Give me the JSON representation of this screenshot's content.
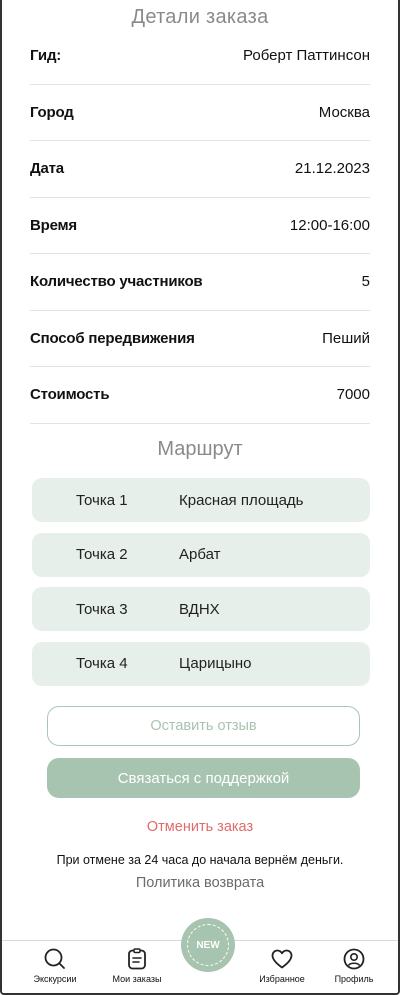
{
  "header": {
    "title": "Детали заказа"
  },
  "details": [
    {
      "label": "Гид:",
      "value": "Роберт Паттинсон"
    },
    {
      "label": "Город",
      "value": "Москва"
    },
    {
      "label": "Дата",
      "value": "21.12.2023"
    },
    {
      "label": "Время",
      "value": "12:00-16:00"
    },
    {
      "label": "Количество участников",
      "value": "5"
    },
    {
      "label": "Способ передвижения",
      "value": "Пеший"
    },
    {
      "label": "Стоимость",
      "value": "7000"
    }
  ],
  "route": {
    "title": "Маршрут",
    "points": [
      {
        "label": "Точка 1",
        "place": "Красная площадь"
      },
      {
        "label": "Точка 2",
        "place": "Арбат"
      },
      {
        "label": "Точка 3",
        "place": "ВДНХ"
      },
      {
        "label": "Точка 4",
        "place": "Царицыно"
      }
    ]
  },
  "actions": {
    "review_label": "Оставить отзыв",
    "support_label": "Связаться с поддержкой",
    "cancel_label": "Отменить заказ",
    "cancel_note": "При отмене за 24 часа до начала вернём деньги.",
    "policy_label": "Политика возврата"
  },
  "tabbar": {
    "tours": {
      "label": "Экскурсии",
      "icon": "search-icon"
    },
    "orders": {
      "label": "Мои заказы",
      "icon": "clipboard-icon"
    },
    "new_badge": {
      "label": "NEW",
      "icon": "new-badge-icon"
    },
    "favorites": {
      "label": "Избранное",
      "icon": "heart-icon"
    },
    "profile": {
      "label": "Профиль",
      "icon": "user-circle-icon"
    }
  },
  "colors": {
    "accent": "#a7c4b0",
    "point_bg": "#e6efe9",
    "cancel": "#e36a6a",
    "muted_title": "#8a8a8a"
  }
}
